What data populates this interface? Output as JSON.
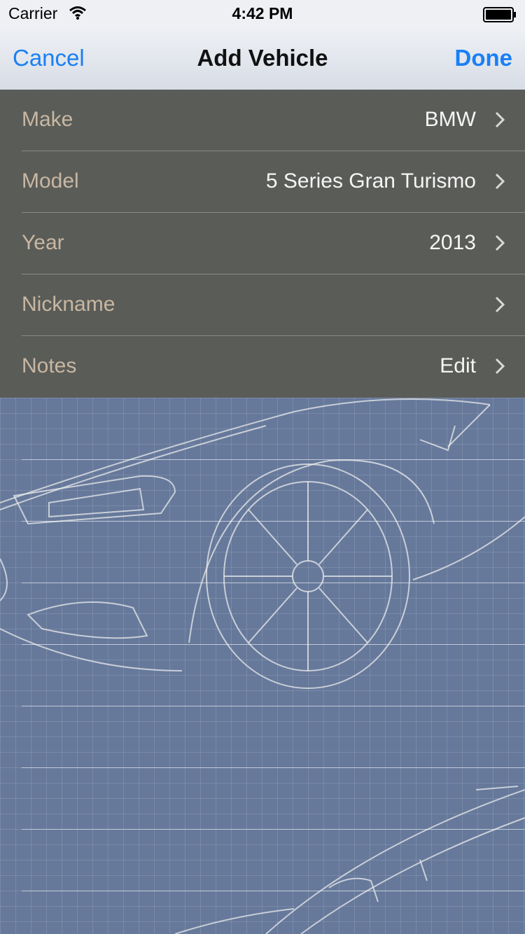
{
  "status_bar": {
    "carrier": "Carrier",
    "time": "4:42 PM"
  },
  "nav": {
    "cancel": "Cancel",
    "title": "Add Vehicle",
    "done": "Done"
  },
  "rows": [
    {
      "label": "Make",
      "value": "BMW"
    },
    {
      "label": "Model",
      "value": "5 Series Gran Turismo"
    },
    {
      "label": "Year",
      "value": "2013"
    },
    {
      "label": "Nickname",
      "value": ""
    },
    {
      "label": "Notes",
      "value": "Edit"
    }
  ],
  "colors": {
    "accent": "#1a7ff5",
    "row_background": "#5a5c58",
    "label": "#c8b7a2",
    "blueprint": "#66799b"
  }
}
